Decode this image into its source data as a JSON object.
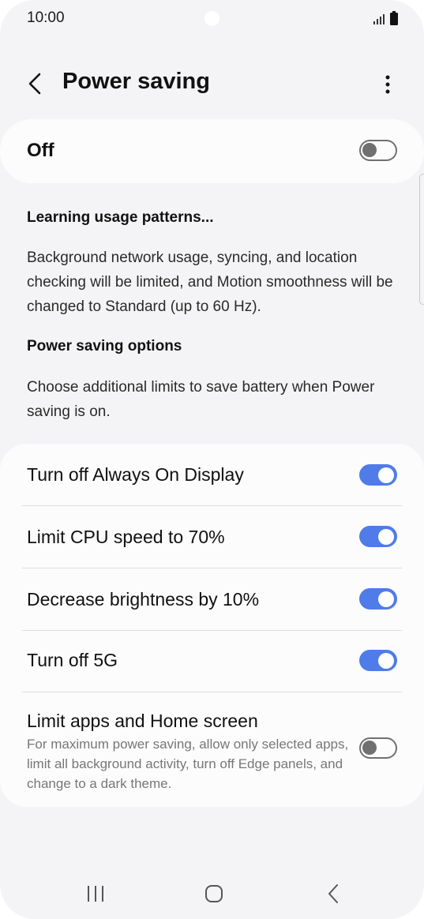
{
  "status_bar": {
    "time": "10:00"
  },
  "header": {
    "title": "Power saving",
    "back_icon": "chevron-left-icon",
    "more_icon": "more-vertical-icon"
  },
  "master": {
    "label": "Off",
    "state": "off"
  },
  "learning": {
    "heading": "Learning usage patterns...",
    "body": "Background network usage, syncing, and location checking will be limited, and Motion smoothness will be changed to Standard (up to 60 Hz)."
  },
  "power_options": {
    "heading": "Power saving options",
    "body": "Choose additional limits to save battery when Power saving is on."
  },
  "options": [
    {
      "label": "Turn off Always On Display",
      "state": "on"
    },
    {
      "label": "Limit CPU speed to 70%",
      "state": "on"
    },
    {
      "label": "Decrease brightness by 10%",
      "state": "on"
    },
    {
      "label": "Turn off 5G",
      "state": "on"
    },
    {
      "label": "Limit apps and Home screen",
      "description": "For maximum power saving, allow only selected apps, limit all background activity, turn off Edge panels, and change to a dark theme.",
      "state": "off"
    }
  ],
  "colors": {
    "accent": "#4f7ce8",
    "background": "#f4f4f6",
    "card": "#fcfcfd"
  }
}
